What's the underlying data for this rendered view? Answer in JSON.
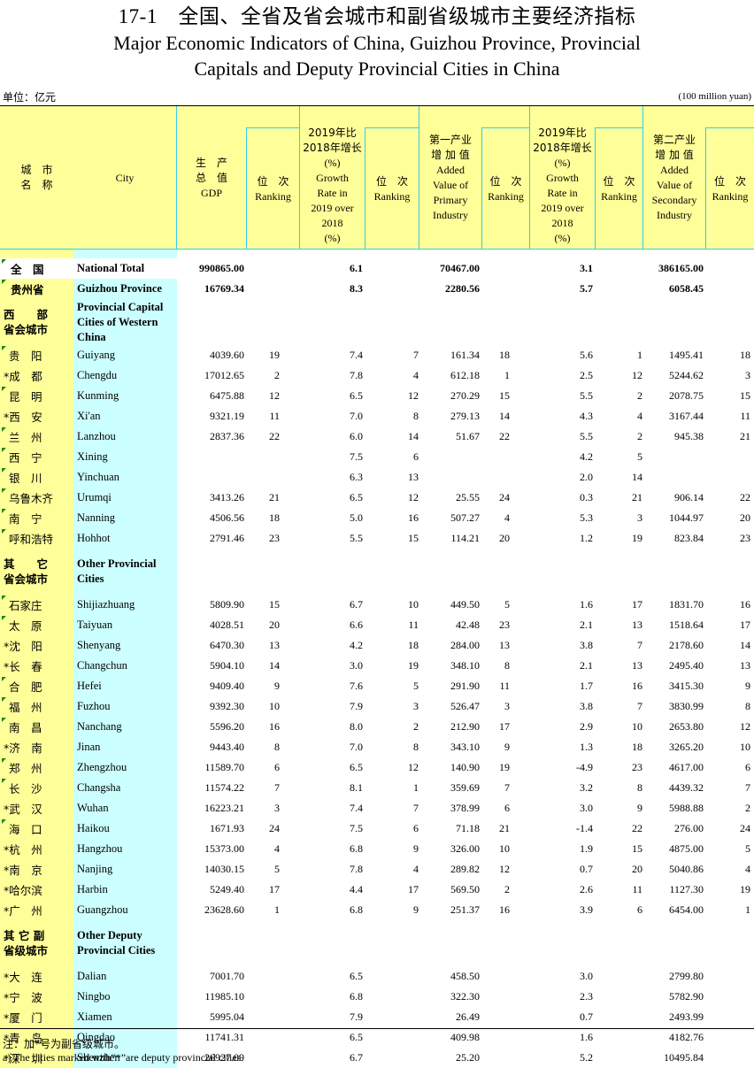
{
  "title": {
    "cn": "17-1　全国、全省及省会城市和副省级城市主要经济指标",
    "en_line1": "Major Economic Indicators of China, Guizhou Province, Provincial",
    "en_line2": "Capitals and Deputy Provincial Cities in China"
  },
  "unit": {
    "cn": "单位：亿元",
    "en": "(100 million yuan)"
  },
  "header": {
    "city_cn": [
      "城　市",
      "名　称"
    ],
    "city_en": "City",
    "gdp": [
      "生　产",
      "总　值",
      "GDP"
    ],
    "ranking": [
      "位　次",
      "Ranking"
    ],
    "growth": [
      "2019年比",
      "2018年增长",
      "(%)",
      "Growth",
      "Rate in",
      "2019 over",
      "2018",
      "(%)"
    ],
    "primary": [
      "第一产业",
      "增 加 值",
      "Added",
      "Value of",
      "Primary",
      "Industry"
    ],
    "secondary": [
      "第二产业",
      "增 加 值",
      "Added",
      "Value of",
      "Secondary",
      "Industry"
    ]
  },
  "rows": [
    {
      "type": "total",
      "cn": "全　国",
      "en": "National Total",
      "v": [
        "990865.00",
        "",
        "6.1",
        "",
        "70467.00",
        "",
        "3.1",
        "",
        "386165.00",
        ""
      ]
    },
    {
      "type": "total2",
      "cn": "贵州省",
      "en": "Guizhou Province",
      "v": [
        "16769.34",
        "",
        "8.3",
        "",
        "2280.56",
        "",
        "5.7",
        "",
        "6058.45",
        ""
      ]
    },
    {
      "type": "group",
      "cn": [
        "西　　部",
        "省会城市"
      ],
      "en": "Provincial Capital Cities of Western China"
    },
    {
      "cn": "贵　阳",
      "en": "Guiyang",
      "v": [
        "4039.60",
        "19",
        "7.4",
        "7",
        "161.34",
        "18",
        "5.6",
        "1",
        "1495.41",
        "18"
      ]
    },
    {
      "cn": "*成　都",
      "en": "Chengdu",
      "v": [
        "17012.65",
        "2",
        "7.8",
        "4",
        "612.18",
        "1",
        "2.5",
        "12",
        "5244.62",
        "3"
      ]
    },
    {
      "cn": "昆　明",
      "en": "Kunming",
      "v": [
        "6475.88",
        "12",
        "6.5",
        "12",
        "270.29",
        "15",
        "5.5",
        "2",
        "2078.75",
        "15"
      ]
    },
    {
      "cn": "*西　安",
      "en": "Xi'an",
      "v": [
        "9321.19",
        "11",
        "7.0",
        "8",
        "279.13",
        "14",
        "4.3",
        "4",
        "3167.44",
        "11"
      ]
    },
    {
      "cn": "兰　州",
      "en": "Lanzhou",
      "v": [
        "2837.36",
        "22",
        "6.0",
        "14",
        "51.67",
        "22",
        "5.5",
        "2",
        "945.38",
        "21"
      ]
    },
    {
      "cn": "西　宁",
      "en": "Xining",
      "v": [
        "",
        "",
        "7.5",
        "6",
        "",
        "",
        "4.2",
        "5",
        "",
        ""
      ]
    },
    {
      "cn": "银　川",
      "en": "Yinchuan",
      "v": [
        "",
        "",
        "6.3",
        "13",
        "",
        "",
        "2.0",
        "14",
        "",
        ""
      ]
    },
    {
      "cn": "乌鲁木齐",
      "en": "Urumqi",
      "v": [
        "3413.26",
        "21",
        "6.5",
        "12",
        "25.55",
        "24",
        "0.3",
        "21",
        "906.14",
        "22"
      ]
    },
    {
      "cn": "南　宁",
      "en": "Nanning",
      "v": [
        "4506.56",
        "18",
        "5.0",
        "16",
        "507.27",
        "4",
        "5.3",
        "3",
        "1044.97",
        "20"
      ]
    },
    {
      "cn": "呼和浩特",
      "en": "Hohhot",
      "v": [
        "2791.46",
        "23",
        "5.5",
        "15",
        "114.21",
        "20",
        "1.2",
        "19",
        "823.84",
        "23"
      ]
    },
    {
      "type": "group",
      "cn": [
        "其　　它",
        "省会城市"
      ],
      "en": "Other Provincial Cities"
    },
    {
      "cn": "石家庄",
      "en": "Shijiazhuang",
      "v": [
        "5809.90",
        "15",
        "6.7",
        "10",
        "449.50",
        "5",
        "1.6",
        "17",
        "1831.70",
        "16"
      ]
    },
    {
      "cn": "太　原",
      "en": "Taiyuan",
      "v": [
        "4028.51",
        "20",
        "6.6",
        "11",
        "42.48",
        "23",
        "2.1",
        "13",
        "1518.64",
        "17"
      ]
    },
    {
      "cn": "*沈　阳",
      "en": "Shenyang",
      "v": [
        "6470.30",
        "13",
        "4.2",
        "18",
        "284.00",
        "13",
        "3.8",
        "7",
        "2178.60",
        "14"
      ]
    },
    {
      "cn": "*长　春",
      "en": "Changchun",
      "v": [
        "5904.10",
        "14",
        "3.0",
        "19",
        "348.10",
        "8",
        "2.1",
        "13",
        "2495.40",
        "13"
      ]
    },
    {
      "cn": "合　肥",
      "en": "Hefei",
      "v": [
        "9409.40",
        "9",
        "7.6",
        "5",
        "291.90",
        "11",
        "1.7",
        "16",
        "3415.30",
        "9"
      ]
    },
    {
      "cn": "福　州",
      "en": "Fuzhou",
      "v": [
        "9392.30",
        "10",
        "7.9",
        "3",
        "526.47",
        "3",
        "3.8",
        "7",
        "3830.99",
        "8"
      ]
    },
    {
      "cn": "南　昌",
      "en": "Nanchang",
      "v": [
        "5596.20",
        "16",
        "8.0",
        "2",
        "212.90",
        "17",
        "2.9",
        "10",
        "2653.80",
        "12"
      ]
    },
    {
      "cn": "*济　南",
      "en": "Jinan",
      "v": [
        "9443.40",
        "8",
        "7.0",
        "8",
        "343.10",
        "9",
        "1.3",
        "18",
        "3265.20",
        "10"
      ]
    },
    {
      "cn": "郑　州",
      "en": "Zhengzhou",
      "v": [
        "11589.70",
        "6",
        "6.5",
        "12",
        "140.90",
        "19",
        "-4.9",
        "23",
        "4617.00",
        "6"
      ]
    },
    {
      "cn": "长　沙",
      "en": "Changsha",
      "v": [
        "11574.22",
        "7",
        "8.1",
        "1",
        "359.69",
        "7",
        "3.2",
        "8",
        "4439.32",
        "7"
      ]
    },
    {
      "cn": "*武　汉",
      "en": "Wuhan",
      "v": [
        "16223.21",
        "3",
        "7.4",
        "7",
        "378.99",
        "6",
        "3.0",
        "9",
        "5988.88",
        "2"
      ]
    },
    {
      "cn": "海　口",
      "en": "Haikou",
      "v": [
        "1671.93",
        "24",
        "7.5",
        "6",
        "71.18",
        "21",
        "-1.4",
        "22",
        "276.00",
        "24"
      ]
    },
    {
      "cn": "*杭　州",
      "en": "Hangzhou",
      "v": [
        "15373.00",
        "4",
        "6.8",
        "9",
        "326.00",
        "10",
        "1.9",
        "15",
        "4875.00",
        "5"
      ]
    },
    {
      "cn": "*南　京",
      "en": "Nanjing",
      "v": [
        "14030.15",
        "5",
        "7.8",
        "4",
        "289.82",
        "12",
        "0.7",
        "20",
        "5040.86",
        "4"
      ]
    },
    {
      "cn": "*哈尔滨",
      "en": "Harbin",
      "v": [
        "5249.40",
        "17",
        "4.4",
        "17",
        "569.50",
        "2",
        "2.6",
        "11",
        "1127.30",
        "19"
      ]
    },
    {
      "cn": "*广　州",
      "en": "Guangzhou",
      "v": [
        "23628.60",
        "1",
        "6.8",
        "9",
        "251.37",
        "16",
        "3.9",
        "6",
        "6454.00",
        "1"
      ]
    },
    {
      "type": "group",
      "cn": [
        "其 它 副",
        "省级城市"
      ],
      "en": "Other Deputy Provincial Cities"
    },
    {
      "cn": "*大　连",
      "en": "Dalian",
      "v": [
        "7001.70",
        "",
        "6.5",
        "",
        "458.50",
        "",
        "3.0",
        "",
        "2799.80",
        ""
      ]
    },
    {
      "cn": "*宁　波",
      "en": "Ningbo",
      "v": [
        "11985.10",
        "",
        "6.8",
        "",
        "322.30",
        "",
        "2.3",
        "",
        "5782.90",
        ""
      ]
    },
    {
      "cn": "*厦　门",
      "en": "Xiamen",
      "v": [
        "5995.04",
        "",
        "7.9",
        "",
        "26.49",
        "",
        "0.7",
        "",
        "2493.99",
        ""
      ]
    },
    {
      "cn": "*青　岛",
      "en": "Qingdao",
      "v": [
        "11741.31",
        "",
        "6.5",
        "",
        "409.98",
        "",
        "1.6",
        "",
        "4182.76",
        ""
      ]
    },
    {
      "cn": "*深　圳",
      "en": "Shenzhen",
      "v": [
        "26927.09",
        "",
        "6.7",
        "",
        "25.20",
        "",
        "5.2",
        "",
        "10495.84",
        ""
      ]
    }
  ],
  "notes": {
    "cn": "注：加*号为副省级城市。",
    "en": "a) The cities marked with“*”are deputy provincial cities."
  }
}
